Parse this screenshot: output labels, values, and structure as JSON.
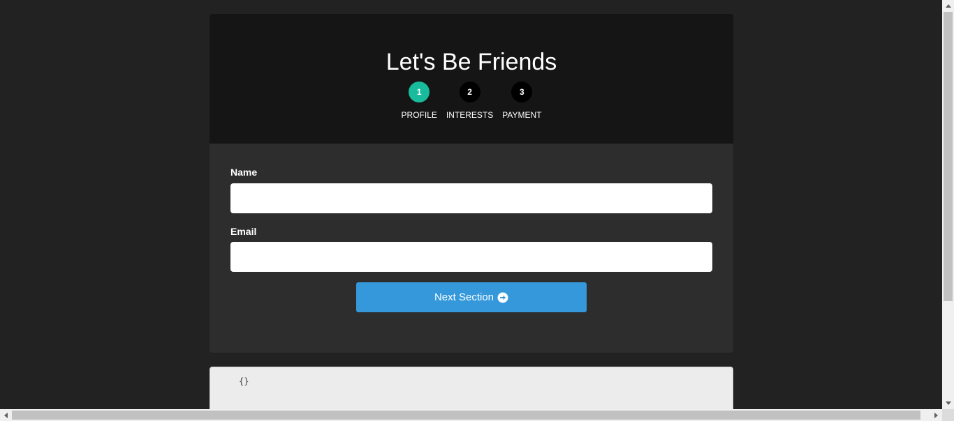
{
  "form": {
    "title": "Let's Be Friends",
    "steps": [
      {
        "number": "1",
        "label": "PROFILE",
        "active": true
      },
      {
        "number": "2",
        "label": "INTERESTS",
        "active": false
      },
      {
        "number": "3",
        "label": "PAYMENT",
        "active": false
      }
    ],
    "fields": {
      "name": {
        "label": "Name",
        "value": "",
        "placeholder": ""
      },
      "email": {
        "label": "Email",
        "value": "",
        "placeholder": ""
      }
    },
    "next_button": {
      "label": "Next Section",
      "icon": "arrow-circle-right-icon"
    }
  },
  "output": {
    "code": "{}"
  },
  "colors": {
    "background": "#222222",
    "header": "#151515",
    "body": "#2d2d2d",
    "step_active": "#18bc9c",
    "step_inactive": "#000000",
    "button": "#3498db"
  }
}
